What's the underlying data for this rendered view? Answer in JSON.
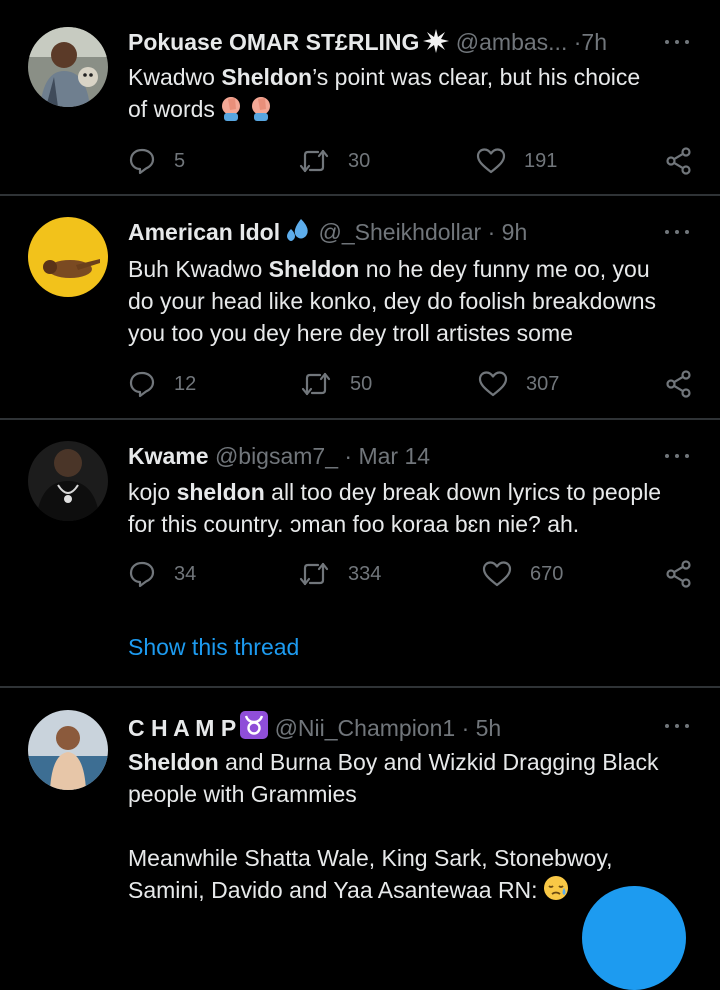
{
  "colors": {
    "background": "#000000",
    "text": "#e7e9ea",
    "muted": "#71767b",
    "accent": "#1d9bf0",
    "divider": "#2f3336"
  },
  "tweets": [
    {
      "name": "Pokuase OMAR ST£RLING",
      "name_badge": "collision-emoji",
      "handle": "@ambas...",
      "sep": "·",
      "time": "7h",
      "body_lines": [
        {
          "a": "Kwadwo ",
          "b": "Sheldon",
          "c": "’s point was clear, but his choice"
        },
        {
          "a": "of words",
          "b": "",
          "c": ""
        }
      ],
      "body_emoji": "facepalm-emoji",
      "replies": "5",
      "retweets": "30",
      "likes": "191"
    },
    {
      "name": "American Idol",
      "name_badge": "sweat-droplets-emoji",
      "handle": "@_Sheikhdollar",
      "sep": "·",
      "time": "9h",
      "body_lines": [
        {
          "a": "Buh Kwadwo ",
          "b": "Sheldon",
          "c": " no he dey funny me oo, you"
        },
        {
          "a": "do your head like konko, dey do foolish breakdowns",
          "b": "",
          "c": ""
        },
        {
          "a": "you too you dey here dey troll artistes some",
          "b": "",
          "c": ""
        }
      ],
      "replies": "12",
      "retweets": "50",
      "likes": "307"
    },
    {
      "name": "Kwame",
      "handle": "@bigsam7_",
      "sep": "·",
      "time": "Mar 14",
      "body_lines": [
        {
          "a": "kojo ",
          "b": "sheldon",
          "c": " all too dey break down lyrics to people"
        },
        {
          "a": "for this country. ɔman foo koraa bɛn nie? ah.",
          "b": "",
          "c": ""
        }
      ],
      "replies": "34",
      "retweets": "334",
      "likes": "670",
      "show_thread": "Show this thread"
    },
    {
      "name": "C H A M P",
      "name_badge": "taurus-emoji",
      "handle": "@Nii_Champion1",
      "sep": "·",
      "time": "5h",
      "body_lines": [
        {
          "a": "",
          "b": "Sheldon",
          "c": " and Burna Boy and Wizkid Dragging Black"
        },
        {
          "a": "people with Grammies",
          "b": "",
          "c": ""
        },
        {
          "a": "",
          "b": "",
          "c": ""
        },
        {
          "a": "Meanwhile Shatta Wale, King Sark, Stonebwoy,",
          "b": "",
          "c": ""
        },
        {
          "a": "Samini, Davido and Yaa Asantewaa RN:",
          "b": "",
          "c": ""
        }
      ],
      "body_emoji": "sad-relieved-emoji"
    }
  ]
}
